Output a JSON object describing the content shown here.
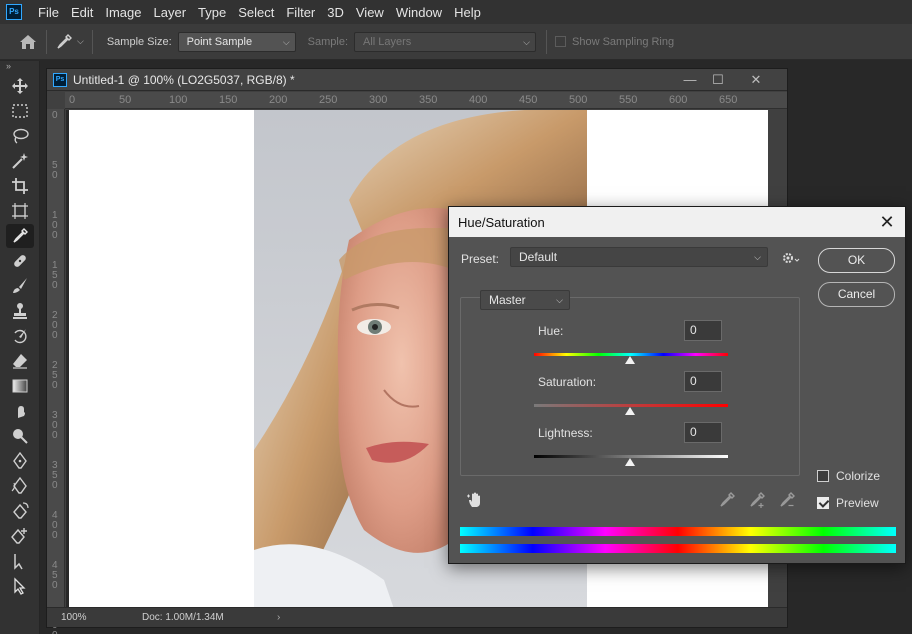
{
  "app": {
    "logo": "Ps",
    "menu": [
      "File",
      "Edit",
      "Image",
      "Layer",
      "Type",
      "Select",
      "Filter",
      "3D",
      "View",
      "Window",
      "Help"
    ]
  },
  "options_bar": {
    "home_icon": "home-icon",
    "tool_icon": "eyedropper-icon",
    "sample_size_label": "Sample Size:",
    "sample_size_value": "Point Sample",
    "sample_label": "Sample:",
    "sample_value": "All Layers",
    "show_ring_label": "Show Sampling Ring"
  },
  "toolbar": {
    "collapse": "»",
    "tools": [
      "move-icon",
      "marquee-icon",
      "lasso-icon",
      "magic-wand-icon",
      "crop-icon",
      "frame-icon",
      "eyedropper-icon",
      "healing-brush-icon",
      "brush-icon",
      "clone-stamp-icon",
      "history-brush-icon",
      "eraser-icon",
      "gradient-icon",
      "smudge-icon",
      "dodge-icon",
      "pen-icon",
      "freeform-pen-icon",
      "curvature-pen-icon",
      "add-anchor-icon",
      "path-select-icon",
      "direct-select-icon"
    ],
    "active_tool": "eyedropper-icon"
  },
  "document": {
    "title": "Untitled-1 @ 100% (LO2G5037, RGB/8) *",
    "ruler_top": [
      "0",
      "50",
      "100",
      "150",
      "200",
      "250",
      "300",
      "350",
      "400",
      "450",
      "500",
      "550",
      "600",
      "650"
    ],
    "ruler_left": [
      "0",
      "5\n0",
      "1\n0\n0",
      "1\n5\n0",
      "2\n0\n0",
      "2\n5\n0",
      "3\n0\n0",
      "3\n5\n0",
      "4\n0\n0",
      "4\n5\n0",
      "5\n0\n0"
    ],
    "zoom": "100%",
    "doc_size": "Doc: 1.00M/1.34M",
    "status_arrow": "›"
  },
  "dialog": {
    "title": "Hue/Saturation",
    "preset_label": "Preset:",
    "preset_value": "Default",
    "ok_label": "OK",
    "cancel_label": "Cancel",
    "channel_value": "Master",
    "hue_label": "Hue:",
    "hue_value": "0",
    "saturation_label": "Saturation:",
    "saturation_value": "0",
    "lightness_label": "Lightness:",
    "lightness_value": "0",
    "colorize_label": "Colorize",
    "colorize_checked": false,
    "preview_label": "Preview",
    "preview_checked": true
  },
  "colors": {
    "app_bg": "#282828",
    "panel": "#323232",
    "dialog_bg": "#535353",
    "accent": "#31a8ff"
  }
}
